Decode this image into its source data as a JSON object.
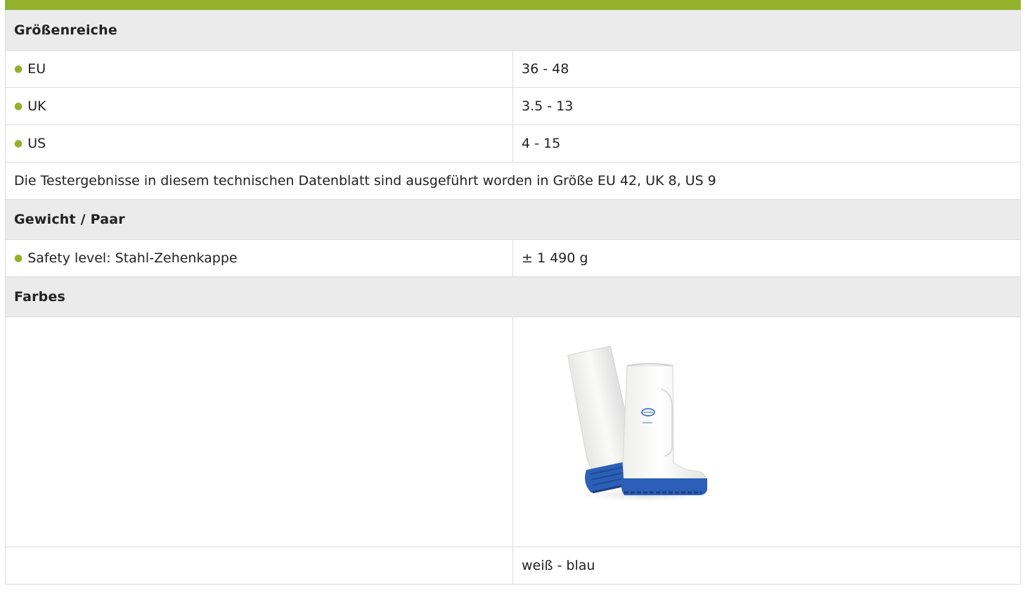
{
  "sections": {
    "sizes": {
      "title": "Größenreiche",
      "rows": [
        {
          "label": "EU",
          "value": "36 - 48"
        },
        {
          "label": "UK",
          "value": "3.5 - 13"
        },
        {
          "label": "US",
          "value": "4 - 15"
        }
      ],
      "note": "Die Testergebnisse in diesem technischen Datenblatt sind ausgeführt worden in Größe EU 42, UK 8, US 9"
    },
    "weight": {
      "title": "Gewicht / Paar",
      "rows": [
        {
          "label": "Safety level: Stahl-Zehenkappe",
          "value": "± 1 490 g"
        }
      ]
    },
    "colors": {
      "title": "Farbes",
      "image_icon": "white-blue-safety-boot-image",
      "color_name": "weiß - blau"
    }
  },
  "theme": {
    "accent": "#94b12b",
    "section_bg": "#ebebeb",
    "boot_white": "#f4f4f2",
    "sole_blue": "#2b5fb8"
  }
}
